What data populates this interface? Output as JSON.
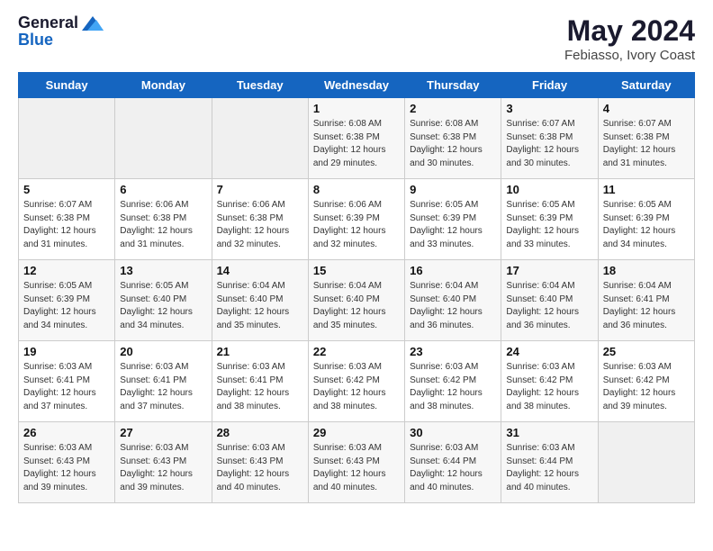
{
  "header": {
    "logo_line1": "General",
    "logo_line2": "Blue",
    "month_year": "May 2024",
    "location": "Febiasso, Ivory Coast"
  },
  "weekdays": [
    "Sunday",
    "Monday",
    "Tuesday",
    "Wednesday",
    "Thursday",
    "Friday",
    "Saturday"
  ],
  "weeks": [
    [
      {
        "day": "",
        "info": ""
      },
      {
        "day": "",
        "info": ""
      },
      {
        "day": "",
        "info": ""
      },
      {
        "day": "1",
        "info": "Sunrise: 6:08 AM\nSunset: 6:38 PM\nDaylight: 12 hours\nand 29 minutes."
      },
      {
        "day": "2",
        "info": "Sunrise: 6:08 AM\nSunset: 6:38 PM\nDaylight: 12 hours\nand 30 minutes."
      },
      {
        "day": "3",
        "info": "Sunrise: 6:07 AM\nSunset: 6:38 PM\nDaylight: 12 hours\nand 30 minutes."
      },
      {
        "day": "4",
        "info": "Sunrise: 6:07 AM\nSunset: 6:38 PM\nDaylight: 12 hours\nand 31 minutes."
      }
    ],
    [
      {
        "day": "5",
        "info": "Sunrise: 6:07 AM\nSunset: 6:38 PM\nDaylight: 12 hours\nand 31 minutes."
      },
      {
        "day": "6",
        "info": "Sunrise: 6:06 AM\nSunset: 6:38 PM\nDaylight: 12 hours\nand 31 minutes."
      },
      {
        "day": "7",
        "info": "Sunrise: 6:06 AM\nSunset: 6:38 PM\nDaylight: 12 hours\nand 32 minutes."
      },
      {
        "day": "8",
        "info": "Sunrise: 6:06 AM\nSunset: 6:39 PM\nDaylight: 12 hours\nand 32 minutes."
      },
      {
        "day": "9",
        "info": "Sunrise: 6:05 AM\nSunset: 6:39 PM\nDaylight: 12 hours\nand 33 minutes."
      },
      {
        "day": "10",
        "info": "Sunrise: 6:05 AM\nSunset: 6:39 PM\nDaylight: 12 hours\nand 33 minutes."
      },
      {
        "day": "11",
        "info": "Sunrise: 6:05 AM\nSunset: 6:39 PM\nDaylight: 12 hours\nand 34 minutes."
      }
    ],
    [
      {
        "day": "12",
        "info": "Sunrise: 6:05 AM\nSunset: 6:39 PM\nDaylight: 12 hours\nand 34 minutes."
      },
      {
        "day": "13",
        "info": "Sunrise: 6:05 AM\nSunset: 6:40 PM\nDaylight: 12 hours\nand 34 minutes."
      },
      {
        "day": "14",
        "info": "Sunrise: 6:04 AM\nSunset: 6:40 PM\nDaylight: 12 hours\nand 35 minutes."
      },
      {
        "day": "15",
        "info": "Sunrise: 6:04 AM\nSunset: 6:40 PM\nDaylight: 12 hours\nand 35 minutes."
      },
      {
        "day": "16",
        "info": "Sunrise: 6:04 AM\nSunset: 6:40 PM\nDaylight: 12 hours\nand 36 minutes."
      },
      {
        "day": "17",
        "info": "Sunrise: 6:04 AM\nSunset: 6:40 PM\nDaylight: 12 hours\nand 36 minutes."
      },
      {
        "day": "18",
        "info": "Sunrise: 6:04 AM\nSunset: 6:41 PM\nDaylight: 12 hours\nand 36 minutes."
      }
    ],
    [
      {
        "day": "19",
        "info": "Sunrise: 6:03 AM\nSunset: 6:41 PM\nDaylight: 12 hours\nand 37 minutes."
      },
      {
        "day": "20",
        "info": "Sunrise: 6:03 AM\nSunset: 6:41 PM\nDaylight: 12 hours\nand 37 minutes."
      },
      {
        "day": "21",
        "info": "Sunrise: 6:03 AM\nSunset: 6:41 PM\nDaylight: 12 hours\nand 38 minutes."
      },
      {
        "day": "22",
        "info": "Sunrise: 6:03 AM\nSunset: 6:42 PM\nDaylight: 12 hours\nand 38 minutes."
      },
      {
        "day": "23",
        "info": "Sunrise: 6:03 AM\nSunset: 6:42 PM\nDaylight: 12 hours\nand 38 minutes."
      },
      {
        "day": "24",
        "info": "Sunrise: 6:03 AM\nSunset: 6:42 PM\nDaylight: 12 hours\nand 38 minutes."
      },
      {
        "day": "25",
        "info": "Sunrise: 6:03 AM\nSunset: 6:42 PM\nDaylight: 12 hours\nand 39 minutes."
      }
    ],
    [
      {
        "day": "26",
        "info": "Sunrise: 6:03 AM\nSunset: 6:43 PM\nDaylight: 12 hours\nand 39 minutes."
      },
      {
        "day": "27",
        "info": "Sunrise: 6:03 AM\nSunset: 6:43 PM\nDaylight: 12 hours\nand 39 minutes."
      },
      {
        "day": "28",
        "info": "Sunrise: 6:03 AM\nSunset: 6:43 PM\nDaylight: 12 hours\nand 40 minutes."
      },
      {
        "day": "29",
        "info": "Sunrise: 6:03 AM\nSunset: 6:43 PM\nDaylight: 12 hours\nand 40 minutes."
      },
      {
        "day": "30",
        "info": "Sunrise: 6:03 AM\nSunset: 6:44 PM\nDaylight: 12 hours\nand 40 minutes."
      },
      {
        "day": "31",
        "info": "Sunrise: 6:03 AM\nSunset: 6:44 PM\nDaylight: 12 hours\nand 40 minutes."
      },
      {
        "day": "",
        "info": ""
      }
    ]
  ]
}
